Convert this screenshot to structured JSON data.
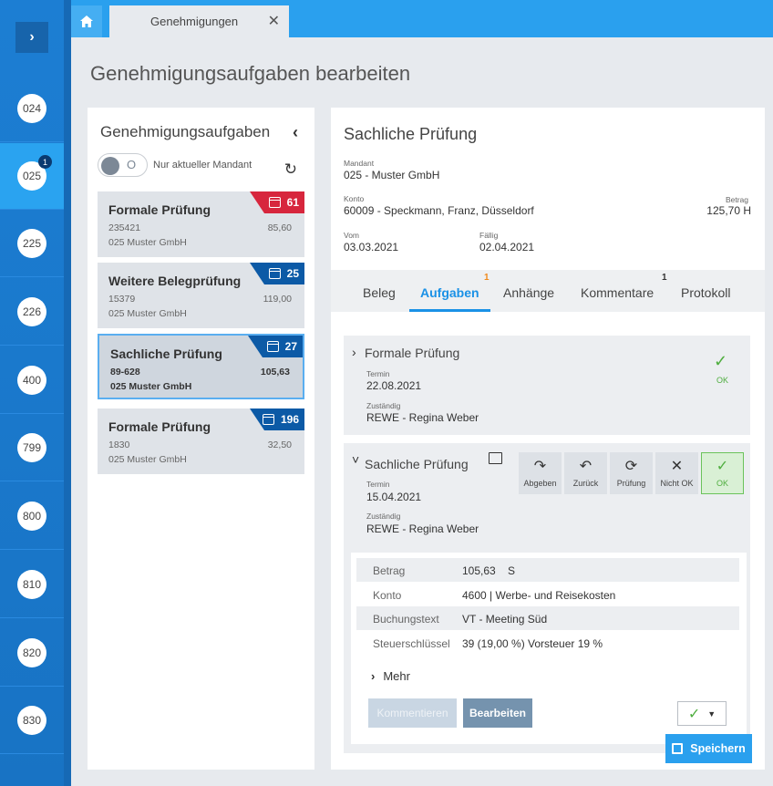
{
  "rail": {
    "toggle_label": "›",
    "items": [
      {
        "label": "024",
        "badge": ""
      },
      {
        "label": "025",
        "badge": "1"
      },
      {
        "label": "225",
        "badge": ""
      },
      {
        "label": "226",
        "badge": ""
      },
      {
        "label": "400",
        "badge": ""
      },
      {
        "label": "799",
        "badge": ""
      },
      {
        "label": "800",
        "badge": ""
      },
      {
        "label": "810",
        "badge": ""
      },
      {
        "label": "820",
        "badge": ""
      },
      {
        "label": "830",
        "badge": ""
      }
    ]
  },
  "tabs_bar": {
    "tab_label": "Genehmigungen",
    "close": "✕"
  },
  "page": {
    "title": "Genehmigungsaufgaben bearbeiten"
  },
  "left_panel": {
    "title": "Genehmigungsaufgaben",
    "toggle_label": "Nur aktueller Mandant",
    "toggle_state": "O",
    "cards": [
      {
        "title": "Formale Prüfung",
        "id": "235421",
        "amount": "85,60",
        "company": "025 Muster GmbH",
        "days": "61",
        "flag_color": "#d7263d"
      },
      {
        "title": "Weitere Belegprüfung",
        "id": "15379",
        "amount": "119,00",
        "company": "025 Muster GmbH",
        "days": "25",
        "flag_color": "#0c5aa6"
      },
      {
        "title": "Sachliche Prüfung",
        "id": "89-628",
        "amount": "105,63",
        "company": "025 Muster GmbH",
        "days": "27",
        "flag_color": "#0c5aa6"
      },
      {
        "title": "Formale Prüfung",
        "id": "1830",
        "amount": "32,50",
        "company": "025 Muster GmbH",
        "days": "196",
        "flag_color": "#0c5aa6"
      }
    ]
  },
  "detail": {
    "title": "Sachliche Prüfung",
    "mandant_label": "Mandant",
    "mandant": "025 - Muster GmbH",
    "konto_label": "Konto",
    "konto": "60009 - Speckmann, Franz, Düsseldorf",
    "betrag_label": "Betrag",
    "betrag": "125,70 H",
    "vom_label": "Vom",
    "vom": "03.03.2021",
    "faellig_label": "Fällig",
    "faellig": "02.04.2021",
    "tabs": [
      {
        "label": "Beleg",
        "badge": ""
      },
      {
        "label": "Aufgaben",
        "badge": "1"
      },
      {
        "label": "Anhänge",
        "badge": ""
      },
      {
        "label": "Kommentare",
        "badge": "1"
      },
      {
        "label": "Protokoll",
        "badge": ""
      }
    ],
    "step1": {
      "title": "Formale Prüfung",
      "termin_label": "Termin",
      "termin": "22.08.2021",
      "zustaendig_label": "Zuständig",
      "zustaendig": "REWE - Regina Weber",
      "status": "OK"
    },
    "step2": {
      "title": "Sachliche Prüfung",
      "termin_label": "Termin",
      "termin": "15.04.2021",
      "zustaendig_label": "Zuständig",
      "zustaendig": "REWE - Regina Weber",
      "actions": [
        "Abgeben",
        "Zurück",
        "Prüfung",
        "Nicht OK",
        "OK"
      ]
    },
    "fields": [
      {
        "key": "Betrag",
        "value": "105,63    S"
      },
      {
        "key": "Konto",
        "value": "4600 | Werbe- und Reisekosten"
      },
      {
        "key": "Buchungstext",
        "value": "VT - Meeting Süd"
      },
      {
        "key": "Steuerschlüssel",
        "value": "39 (19,00 %) Vorsteuer 19 %"
      }
    ],
    "more_label": "Mehr",
    "comment_btn": "Kommentieren",
    "edit_btn": "Bearbeiten",
    "save_btn": "Speichern"
  },
  "colors": {
    "accent": "#2aa0ee",
    "rail": "#1c7ed3",
    "ok": "#4fae3f",
    "overdue": "#d7263d",
    "due": "#0c5aa6"
  }
}
